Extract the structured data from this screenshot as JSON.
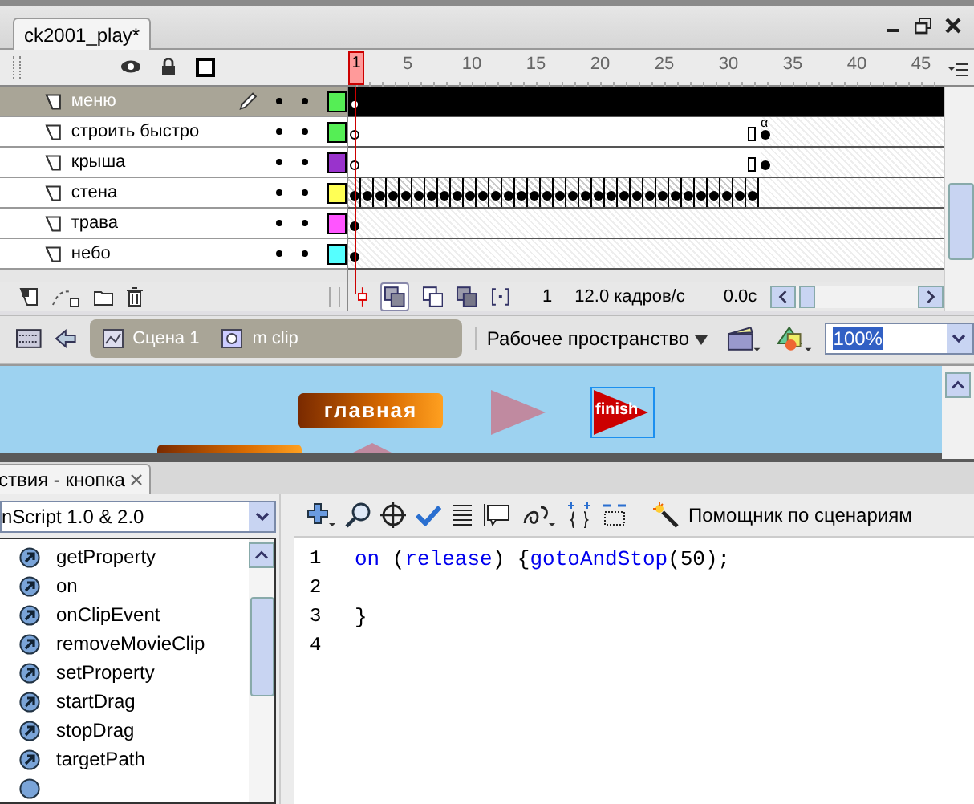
{
  "document_tab": {
    "title": "ck2001_play*"
  },
  "timeline": {
    "ruler": [
      "1",
      "5",
      "10",
      "15",
      "20",
      "25",
      "30",
      "35",
      "40",
      "45"
    ],
    "layers": [
      {
        "name": "меню",
        "selected": true,
        "color": "#55ee55",
        "kind": "blank"
      },
      {
        "name": "строить быстро",
        "selected": false,
        "color": "#55ee55",
        "kind": "tween"
      },
      {
        "name": "крыша",
        "selected": false,
        "color": "#9933cc",
        "kind": "tween"
      },
      {
        "name": "стена",
        "selected": false,
        "color": "#ffff55",
        "kind": "keyframes"
      },
      {
        "name": "трава",
        "selected": false,
        "color": "#ff55ff",
        "kind": "single"
      },
      {
        "name": "небо",
        "selected": false,
        "color": "#55ffff",
        "kind": "single"
      }
    ],
    "tween_marker": "α",
    "current_frame": "1",
    "frame_rate": "12.0 кадров/с",
    "elapsed_time": "0.0c"
  },
  "edit_bar": {
    "scene": "Сцена 1",
    "symbol": "m clip",
    "workspace": "Рабочее пространство",
    "zoom": "100%"
  },
  "stage": {
    "buttons": [
      {
        "kind": "text-button",
        "label": "главная"
      },
      {
        "kind": "triangle",
        "selected": false
      },
      {
        "kind": "triangle",
        "selected": true,
        "label": "finish"
      }
    ]
  },
  "actions_panel": {
    "tab": "ствия - кнопка",
    "version": "nScript 1.0 & 2.0",
    "items": [
      "getProperty",
      "on",
      "onClipEvent",
      "removeMovieClip",
      "setProperty",
      "startDrag",
      "stopDrag",
      "targetPath"
    ],
    "assistant": "Помощник по сценариям",
    "code": [
      {
        "number": "1",
        "tokens": [
          {
            "text": "on",
            "kind": "keyword"
          },
          {
            "text": " (",
            "kind": "plain"
          },
          {
            "text": "release",
            "kind": "keyword"
          },
          {
            "text": ") {",
            "kind": "plain"
          },
          {
            "text": "gotoAndStop",
            "kind": "keyword"
          },
          {
            "text": "(50);",
            "kind": "plain"
          }
        ]
      },
      {
        "number": "2"
      },
      {
        "number": "3",
        "tokens": [
          {
            "text": "}",
            "kind": "plain"
          }
        ]
      },
      {
        "number": "4"
      }
    ]
  }
}
